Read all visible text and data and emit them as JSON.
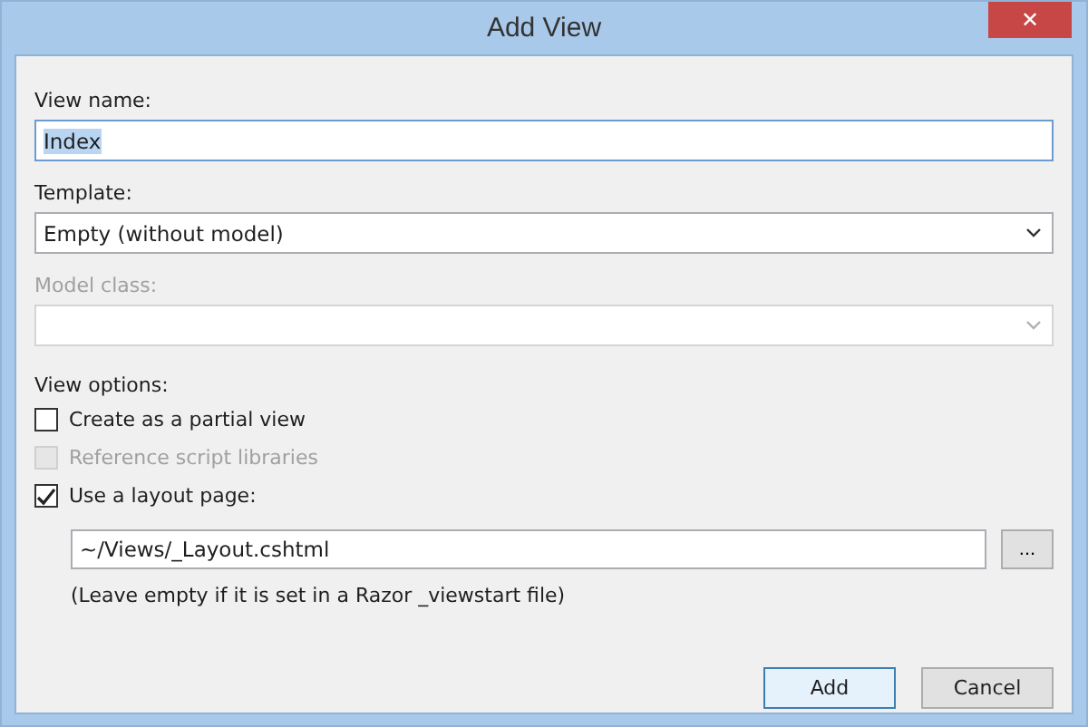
{
  "window": {
    "title": "Add View",
    "close": "✕"
  },
  "view_name": {
    "label": "View name:",
    "value": "Index",
    "selected_text": true
  },
  "template": {
    "label": "Template:",
    "value": "Empty (without model)",
    "disabled": false
  },
  "model_class": {
    "label": "Model class:",
    "disabled": true
  },
  "view_options": {
    "label": "View options:",
    "options": [
      {
        "label": "Create as a partial view",
        "checked": false,
        "disabled": false
      },
      {
        "label": "Reference script libraries",
        "checked": false,
        "disabled": true
      },
      {
        "label": "Use a layout page:",
        "checked": true,
        "disabled": false
      }
    ]
  },
  "layout_page": {
    "value": "~/Views/_Layout.cshtml",
    "browse": "...",
    "note": "(Leave empty if it is set in a Razor _viewstart file)"
  },
  "buttons": [
    "Add",
    "Cancel"
  ]
}
